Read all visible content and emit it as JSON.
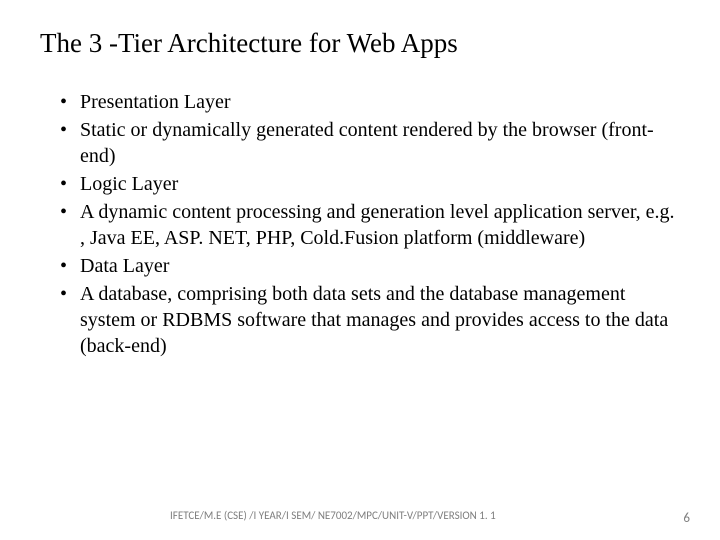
{
  "title": "The 3 -Tier Architecture for Web Apps",
  "bullets": [
    "Presentation Layer",
    "Static or dynamically generated content rendered by the browser (front-end)",
    "Logic Layer",
    "A dynamic content processing and generation level application server, e.g. , Java EE, ASP. NET, PHP, Cold.Fusion platform (middleware)",
    "Data Layer",
    "A database, comprising both data sets and the database management system or RDBMS software that manages and provides access to the data (back-end)"
  ],
  "footer": "IFETCE/M.E (CSE) /I YEAR/I SEM/ NE7002/MPC/UNIT-V/PPT/VERSION 1. 1",
  "page": "6"
}
